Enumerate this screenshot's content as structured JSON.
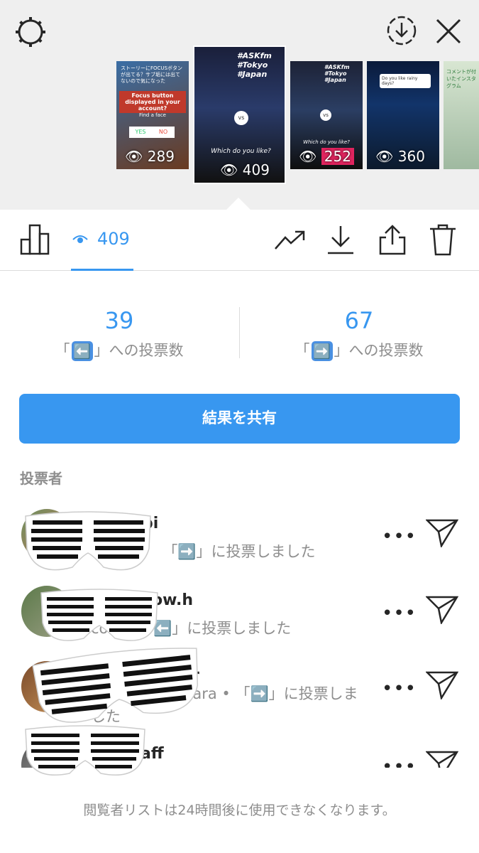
{
  "header": {
    "settings_icon": "gear-icon",
    "download_icon": "download-circle-icon",
    "close_icon": "close-icon"
  },
  "thumbnails": [
    {
      "views": "289",
      "caption": "Focus button displayed in your account?",
      "sub": "Find a face",
      "yes": "YES",
      "no": "NO",
      "top_text": "ストーリーにFOCUSボタンが出てる？サブ垢には出てないので気になった"
    },
    {
      "views": "409",
      "caption": "Which do you like?",
      "tags": "#ASKfm #Tokyo #Japan",
      "vs": "vs"
    },
    {
      "views": "252",
      "caption": "Which do you like?",
      "tags": "#ASKfm #Tokyo #Japan",
      "vs": "vs"
    },
    {
      "views": "360",
      "caption": "Do you like rainy days?"
    },
    {
      "views": "",
      "caption": "コメントが付いたインスタグラム"
    }
  ],
  "toolbar": {
    "view_count": "409",
    "icons": [
      "bar-chart-icon",
      "eye-icon",
      "insights-icon",
      "download-icon",
      "share-icon",
      "trash-icon"
    ]
  },
  "results": {
    "left_count": "39",
    "left_label_pre": "「",
    "left_emoji": "⬅️",
    "left_label_post": "」への投票数",
    "right_count": "67",
    "right_label_pre": "「",
    "right_emoji": "➡️",
    "right_label_post": "」への投票数"
  },
  "share_button": "結果を共有",
  "voters_title": "投票者",
  "voters": [
    {
      "username": "pi",
      "sub_pre": "C",
      "sub": "「➡️」に投票しました"
    },
    {
      "username": "ow.h",
      "sub_pre": "co",
      "sub": "「⬅️」に投票しました"
    },
    {
      "username": "r",
      "sub_pre": "am",
      "sub_name": "hara •",
      "sub": "「➡️」に投票しました"
    },
    {
      "username": "aff",
      "sub_pre": "",
      "sub": ""
    }
  ],
  "more_label": "•••",
  "footer": "閲覧者リストは24時間後に使用できなくなります。",
  "colors": {
    "accent": "#3897f0",
    "muted": "#8e8e8e",
    "strip_bg": "#efefef"
  }
}
